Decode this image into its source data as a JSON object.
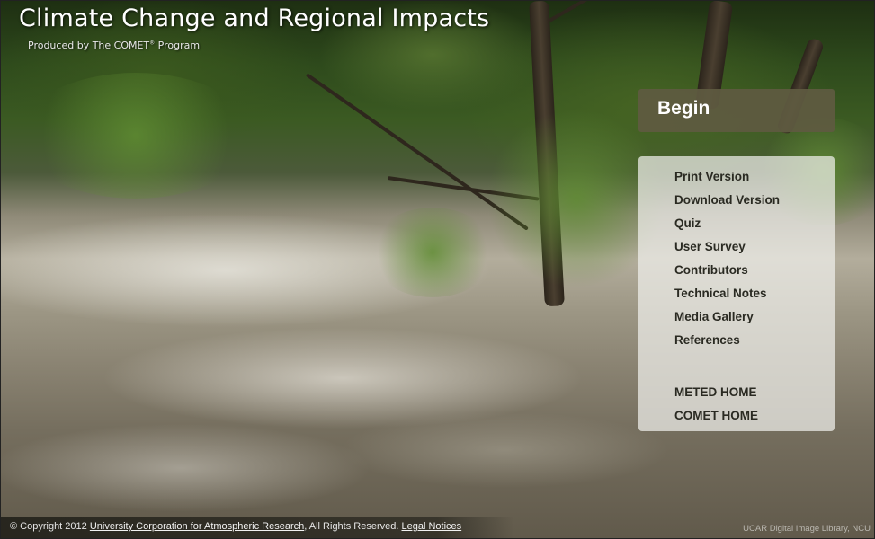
{
  "header": {
    "title": "Climate Change and Regional Impacts",
    "subtitle_prefix": "Produced by The COMET",
    "subtitle_reg": "®",
    "subtitle_suffix": " Program"
  },
  "begin_button": {
    "label": "Begin"
  },
  "menu": {
    "items": [
      "Print Version",
      "Download Version",
      "Quiz",
      "User Survey",
      "Contributors",
      "Technical Notes",
      "Media Gallery",
      "References"
    ],
    "home_links": [
      "METED HOME",
      "COMET HOME"
    ]
  },
  "footer": {
    "copyright": "© Copyright 2012 ",
    "org_link": "University Corporation for Atmospheric Research",
    "rights": ", All Rights Reserved. ",
    "legal_link": "Legal Notices"
  },
  "image_credit": "UCAR Digital Image Library, NCU",
  "colors": {
    "begin_bg": "#5f5a41",
    "menu_bg": "#f0f0eb",
    "menu_text": "#2a2a22"
  }
}
